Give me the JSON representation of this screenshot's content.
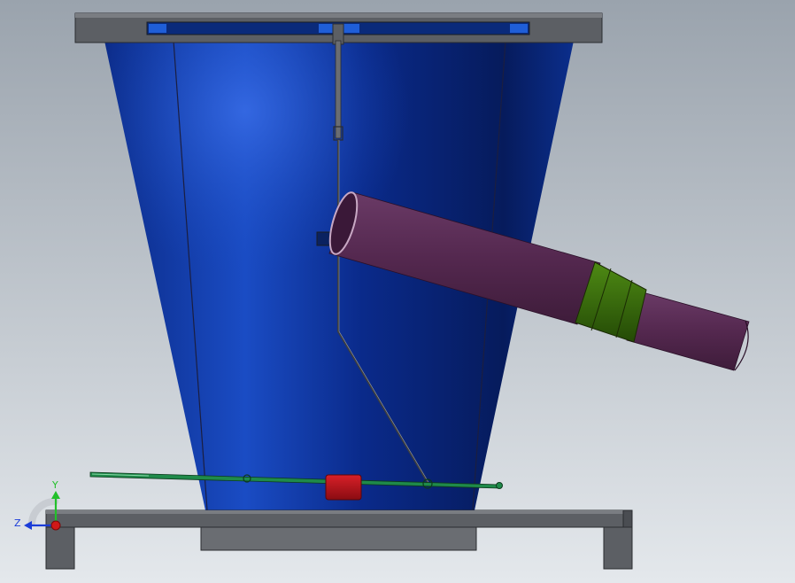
{
  "viewport": {
    "background_top": "#9aa3ad",
    "background_bottom": "#e4e8ec"
  },
  "colors": {
    "hopper_blue": "#0a2e8a",
    "hopper_highlight": "#2a5fd6",
    "hopper_shadow": "#051550",
    "frame_gray": "#5a5d62",
    "frame_top": "#6b6e73",
    "rod_dark": "#3a3d42",
    "pipe_purple": "#54284f",
    "pipe_rim": "#8a5a86",
    "collar_green": "#3a6b0c",
    "lever_green": "#1f8a4a",
    "counterweight_red": "#b3141c",
    "axis_y": "#22c02a",
    "axis_z": "#1a3cd8",
    "axis_origin": "#d01818"
  },
  "triad": {
    "y_label": "Y",
    "z_label": "Z"
  }
}
